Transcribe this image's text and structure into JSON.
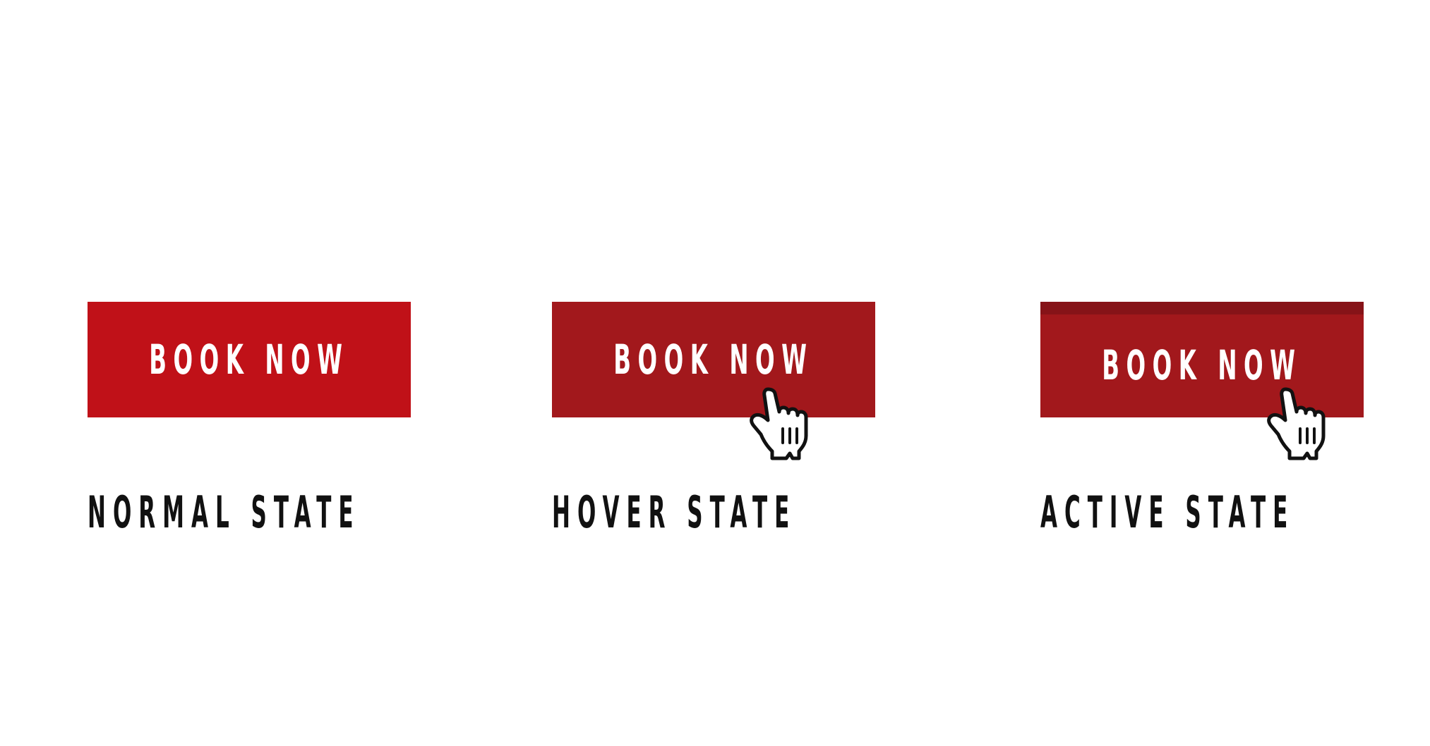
{
  "states": [
    {
      "button_label": "BOOK NOW",
      "state_label": "NORMAL STATE"
    },
    {
      "button_label": "BOOK NOW",
      "state_label": "HOVER STATE"
    },
    {
      "button_label": "BOOK NOW",
      "state_label": "ACTIVE STATE"
    }
  ],
  "colors": {
    "normal": "#c01118",
    "hover": "#a2181c",
    "active": "#a2181c",
    "active_top_border": "#861318",
    "label_text": "#111111",
    "button_text": "#ffffff"
  },
  "icons": [
    "pointer-hand-icon"
  ]
}
